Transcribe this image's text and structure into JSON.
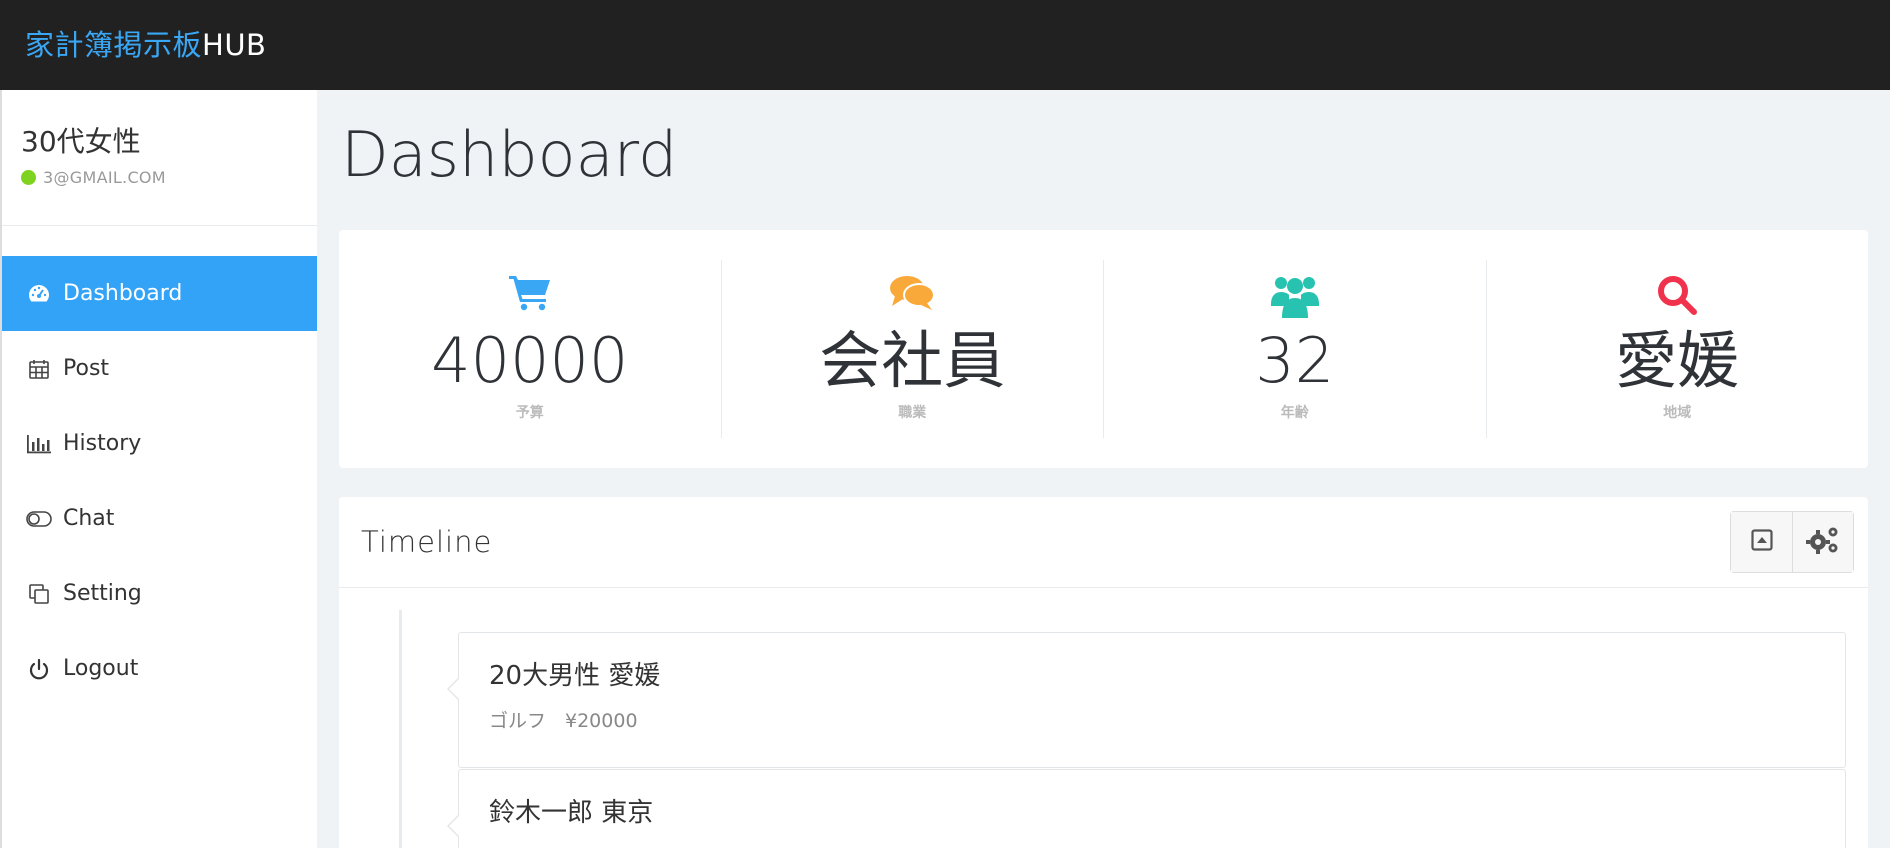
{
  "brand": {
    "jp": "家計簿掲示板",
    "en": "HUB"
  },
  "profile": {
    "name": "30代女性",
    "email": "3@GMAIL.COM"
  },
  "nav": [
    {
      "label": "Dashboard",
      "icon": "dashboard-icon",
      "active": true
    },
    {
      "label": "Post",
      "icon": "calendar-icon"
    },
    {
      "label": "History",
      "icon": "bar-chart-icon"
    },
    {
      "label": "Chat",
      "icon": "toggle-icon"
    },
    {
      "label": "Setting",
      "icon": "copy-icon"
    },
    {
      "label": "Logout",
      "icon": "power-icon"
    }
  ],
  "page": {
    "title": "Dashboard"
  },
  "stats": [
    {
      "value": "40000",
      "label": "予算",
      "icon": "cart-icon",
      "color": "#3aa7f5"
    },
    {
      "value": "会社員",
      "label": "職業",
      "icon": "comments-icon",
      "color": "#f9a93a"
    },
    {
      "value": "32",
      "label": "年齢",
      "icon": "users-icon",
      "color": "#27c3b0"
    },
    {
      "value": "愛媛",
      "label": "地域",
      "icon": "search-icon",
      "color": "#f0324d"
    }
  ],
  "timeline": {
    "title": "Timeline",
    "items": [
      {
        "title": "20大男性 愛媛",
        "subtitle": "ゴルフ　¥20000"
      },
      {
        "title": "鈴木一郎 東京",
        "subtitle": ""
      }
    ]
  },
  "colors": {
    "accent": "#33a3f8",
    "topbar": "#212121",
    "status": "#7ed321"
  }
}
